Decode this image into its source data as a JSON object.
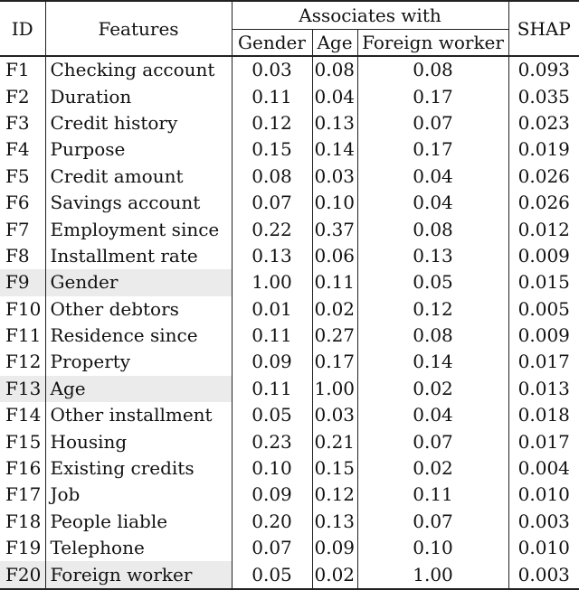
{
  "table": {
    "headers": {
      "id": "ID",
      "features": "Features",
      "associates_group": "Associates with",
      "gender": "Gender",
      "age": "Age",
      "foreign_worker": "Foreign worker",
      "shap": "SHAP"
    },
    "rows": [
      {
        "id": "F1",
        "feature": "Checking account",
        "gender": "0.03",
        "age": "0.08",
        "foreign_worker": "0.08",
        "shap": "0.093",
        "highlighted": false
      },
      {
        "id": "F2",
        "feature": "Duration",
        "gender": "0.11",
        "age": "0.04",
        "foreign_worker": "0.17",
        "shap": "0.035",
        "highlighted": false
      },
      {
        "id": "F3",
        "feature": "Credit history",
        "gender": "0.12",
        "age": "0.13",
        "foreign_worker": "0.07",
        "shap": "0.023",
        "highlighted": false
      },
      {
        "id": "F4",
        "feature": "Purpose",
        "gender": "0.15",
        "age": "0.14",
        "foreign_worker": "0.17",
        "shap": "0.019",
        "highlighted": false
      },
      {
        "id": "F5",
        "feature": "Credit amount",
        "gender": "0.08",
        "age": "0.03",
        "foreign_worker": "0.04",
        "shap": "0.026",
        "highlighted": false
      },
      {
        "id": "F6",
        "feature": "Savings account",
        "gender": "0.07",
        "age": "0.10",
        "foreign_worker": "0.04",
        "shap": "0.026",
        "highlighted": false
      },
      {
        "id": "F7",
        "feature": "Employment since",
        "gender": "0.22",
        "age": "0.37",
        "foreign_worker": "0.08",
        "shap": "0.012",
        "highlighted": false
      },
      {
        "id": "F8",
        "feature": "Installment rate",
        "gender": "0.13",
        "age": "0.06",
        "foreign_worker": "0.13",
        "shap": "0.009",
        "highlighted": false
      },
      {
        "id": "F9",
        "feature": "Gender",
        "gender": "1.00",
        "age": "0.11",
        "foreign_worker": "0.05",
        "shap": "0.015",
        "highlighted": true
      },
      {
        "id": "F10",
        "feature": "Other debtors",
        "gender": "0.01",
        "age": "0.02",
        "foreign_worker": "0.12",
        "shap": "0.005",
        "highlighted": false
      },
      {
        "id": "F11",
        "feature": "Residence since",
        "gender": "0.11",
        "age": "0.27",
        "foreign_worker": "0.08",
        "shap": "0.009",
        "highlighted": false
      },
      {
        "id": "F12",
        "feature": "Property",
        "gender": "0.09",
        "age": "0.17",
        "foreign_worker": "0.14",
        "shap": "0.017",
        "highlighted": false
      },
      {
        "id": "F13",
        "feature": "Age",
        "gender": "0.11",
        "age": "1.00",
        "foreign_worker": "0.02",
        "shap": "0.013",
        "highlighted": true
      },
      {
        "id": "F14",
        "feature": "Other installment",
        "gender": "0.05",
        "age": "0.03",
        "foreign_worker": "0.04",
        "shap": "0.018",
        "highlighted": false
      },
      {
        "id": "F15",
        "feature": "Housing",
        "gender": "0.23",
        "age": "0.21",
        "foreign_worker": "0.07",
        "shap": "0.017",
        "highlighted": false
      },
      {
        "id": "F16",
        "feature": "Existing credits",
        "gender": "0.10",
        "age": "0.15",
        "foreign_worker": "0.02",
        "shap": "0.004",
        "highlighted": false
      },
      {
        "id": "F17",
        "feature": "Job",
        "gender": "0.09",
        "age": "0.12",
        "foreign_worker": "0.11",
        "shap": "0.010",
        "highlighted": false
      },
      {
        "id": "F18",
        "feature": "People liable",
        "gender": "0.20",
        "age": "0.13",
        "foreign_worker": "0.07",
        "shap": "0.003",
        "highlighted": false
      },
      {
        "id": "F19",
        "feature": "Telephone",
        "gender": "0.07",
        "age": "0.09",
        "foreign_worker": "0.10",
        "shap": "0.010",
        "highlighted": false
      },
      {
        "id": "F20",
        "feature": "Foreign worker",
        "gender": "0.05",
        "age": "0.02",
        "foreign_worker": "1.00",
        "shap": "0.003",
        "highlighted": true
      }
    ],
    "colors": {
      "highlight_background": "#ebebeb",
      "rule": "#222222",
      "text": "#111111"
    }
  }
}
